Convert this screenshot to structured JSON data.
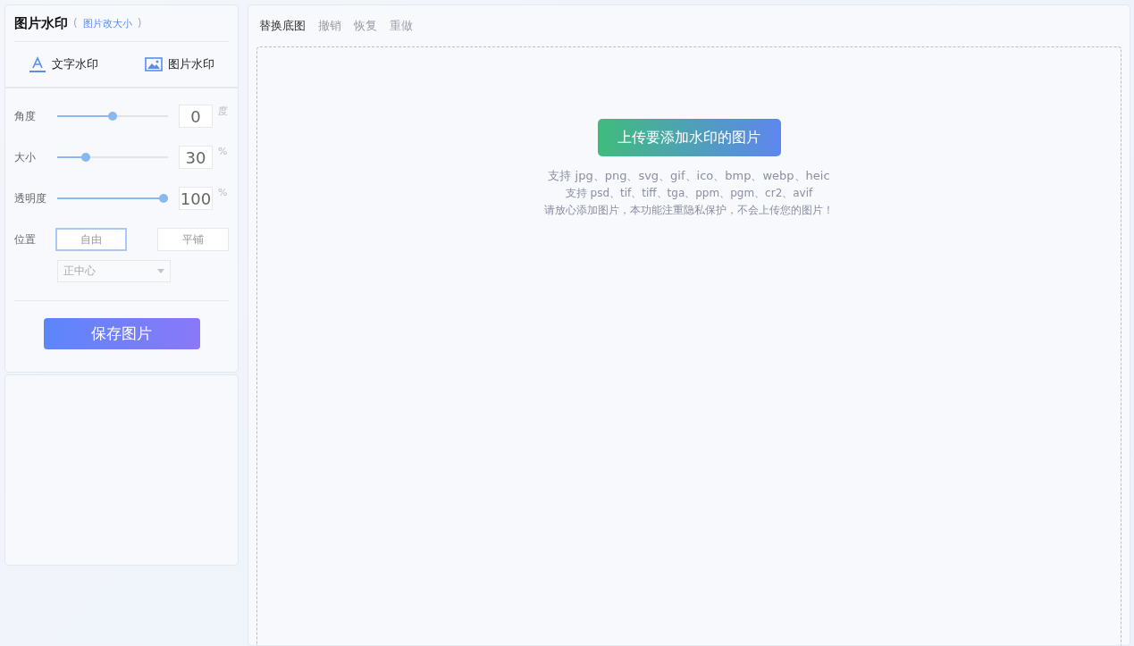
{
  "panel": {
    "title": "图片水印",
    "paren_open": "(",
    "link": "图片改大小",
    "paren_close": ")"
  },
  "tabs": [
    {
      "label": "文字水印",
      "kind": "text"
    },
    {
      "label": "图片水印",
      "kind": "image"
    }
  ],
  "sliders": [
    {
      "label": "角度",
      "level": 0.5,
      "value": "0",
      "unit": "度"
    },
    {
      "label": "大小",
      "level": 0.24,
      "value": "30",
      "unit": "%"
    },
    {
      "label": "透明度",
      "level": 1,
      "value": "100",
      "unit": "%"
    }
  ],
  "position": {
    "label": "位置",
    "modes": [
      {
        "label": "自由",
        "selected": true
      },
      {
        "label": "平铺",
        "selected": false
      }
    ],
    "anchor": "正中心"
  },
  "save_button": "保存图片",
  "toolbar": [
    {
      "label": "替换底图",
      "disabled": false
    },
    {
      "label": "撤销",
      "disabled": true
    },
    {
      "label": "恢复",
      "disabled": true
    },
    {
      "label": "重做",
      "disabled": true
    }
  ],
  "upload": {
    "button": "上传要添加水印的图片",
    "lines": [
      "支持 jpg、png、svg、gif、ico、bmp、webp、heic",
      "支持 psd、tif、tiff、tga、ppm、pgm、cr2、avif",
      "请放心添加图片，本功能注重隐私保护，不会上传您的图片！"
    ]
  }
}
